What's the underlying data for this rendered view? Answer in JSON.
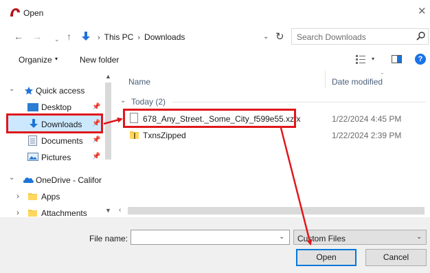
{
  "window": {
    "title": "Open",
    "close_glyph": "✕"
  },
  "nav": {
    "back_glyph": "←",
    "forward_glyph": "→",
    "recent_glyph": "⌄",
    "up_glyph": "↑",
    "breadcrumb": [
      "This PC",
      "Downloads"
    ],
    "breadcrumb_sep": "›",
    "address_dropdown_glyph": "⌄",
    "refresh_glyph": "↻",
    "search_placeholder": "Search Downloads"
  },
  "toolbar": {
    "organize_label": "Organize",
    "organize_caret": "▾",
    "new_folder_label": "New folder",
    "view_caret": "▾",
    "help_glyph": "?"
  },
  "sidebar": {
    "scroll_up": "▲",
    "scroll_down": "▼",
    "pin_glyph": "📌",
    "items": [
      {
        "label": "Quick access",
        "icon": "star-icon",
        "chevron": "⌄"
      },
      {
        "label": "Desktop",
        "icon": "desktop-icon"
      },
      {
        "label": "Downloads",
        "icon": "download-arrow-icon"
      },
      {
        "label": "Documents",
        "icon": "documents-icon"
      },
      {
        "label": "Pictures",
        "icon": "pictures-icon"
      },
      {
        "label": "OneDrive - Califor",
        "icon": "onedrive-cloud-icon",
        "chevron": "⌄"
      },
      {
        "label": "Apps",
        "icon": "folder-icon",
        "chevron": "›"
      },
      {
        "label": "Attachments",
        "icon": "folder-icon",
        "chevron": "›"
      }
    ]
  },
  "content": {
    "columns": {
      "name": "Name",
      "date_modified": "Date modified"
    },
    "sort_caret": "⌄",
    "group": {
      "chevron": "⌄",
      "label": "Today (2)"
    },
    "files": [
      {
        "name": "678_Any_Street._Some_City_f599e55.xzfx",
        "date": "1/22/2024 4:45 PM",
        "icon": "document-file-icon"
      },
      {
        "name": "TxnsZipped",
        "date": "1/22/2024 2:39 PM",
        "icon": "zip-folder-icon"
      }
    ],
    "hscroll_left": "‹"
  },
  "bottom": {
    "file_name_label": "File name:",
    "file_name_value": "",
    "file_name_dropdown": "⌄",
    "file_type_value": "Custom Files",
    "file_type_dropdown": "⌄",
    "open_label": "Open",
    "cancel_label": "Cancel"
  },
  "colors": {
    "annotation_red": "#e0161b",
    "selection_blue": "#cce8ff",
    "accent_blue": "#0078d7"
  }
}
